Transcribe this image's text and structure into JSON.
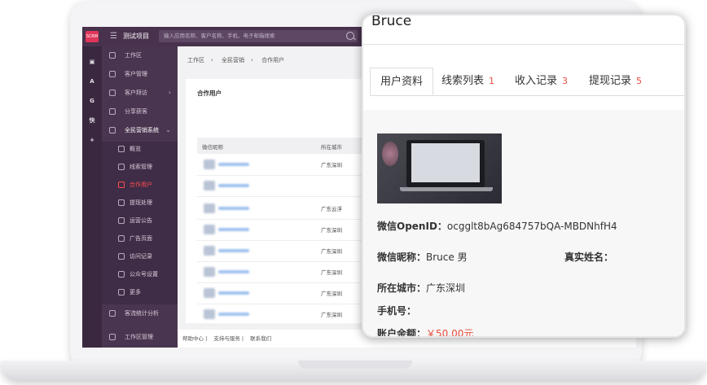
{
  "app": {
    "brand_text": "SCRM",
    "project_name": "测试项目",
    "search_placeholder": "输入应用名称、客户名称、手机、电子邮箱搜索"
  },
  "rail": [
    "A",
    "G",
    "快",
    "+"
  ],
  "sidebar": {
    "items": [
      {
        "label": "工作区"
      },
      {
        "label": "客户管理"
      },
      {
        "label": "客户拜访"
      },
      {
        "label": "分享获客"
      },
      {
        "label": "全民营销系统"
      }
    ],
    "sub_items": [
      {
        "label": "概览"
      },
      {
        "label": "线索管理"
      },
      {
        "label": "合作用户"
      },
      {
        "label": "提现处理"
      },
      {
        "label": "运营公告"
      },
      {
        "label": "广告页面"
      },
      {
        "label": "访问记录"
      },
      {
        "label": "公众号设置"
      },
      {
        "label": "更多"
      }
    ],
    "bottom_items": [
      {
        "label": "客流统计分析"
      },
      {
        "label": "工作区管理"
      }
    ]
  },
  "breadcrumb": [
    "工作区",
    "全民营销",
    "合作用户"
  ],
  "card": {
    "title": "合作用户",
    "columns": [
      "微信昵称",
      "所在城市"
    ],
    "rows": [
      {
        "city": "广东深圳"
      },
      {
        "city": ""
      },
      {
        "city": "广东云浮"
      },
      {
        "city": "广东深圳"
      },
      {
        "city": "广东深圳"
      },
      {
        "city": "广东深圳"
      },
      {
        "city": "广东深圳"
      },
      {
        "city": "广东深圳"
      }
    ]
  },
  "footer": [
    "帮助中心",
    "支持与服务",
    "联系我们"
  ],
  "popup": {
    "name": "Bruce",
    "tabs": [
      {
        "label": "用户资料",
        "count": ""
      },
      {
        "label": "线索列表",
        "count": "1"
      },
      {
        "label": "收入记录",
        "count": "3"
      },
      {
        "label": "提现记录",
        "count": "5"
      }
    ],
    "openid_label": "微信OpenID：",
    "openid_value": "ocgglt8bAg684757bQA-MBDNhfH4",
    "nickname_label": "微信昵称：",
    "nickname_value": "Bruce 男",
    "realname_label": "真实姓名：",
    "city_label": "所在城市：",
    "city_value": "广东深圳",
    "phone_label": "手机号：",
    "balance_label": "账户余额：",
    "balance_value": "￥50.00元",
    "accent_color": "#e74c3c"
  }
}
